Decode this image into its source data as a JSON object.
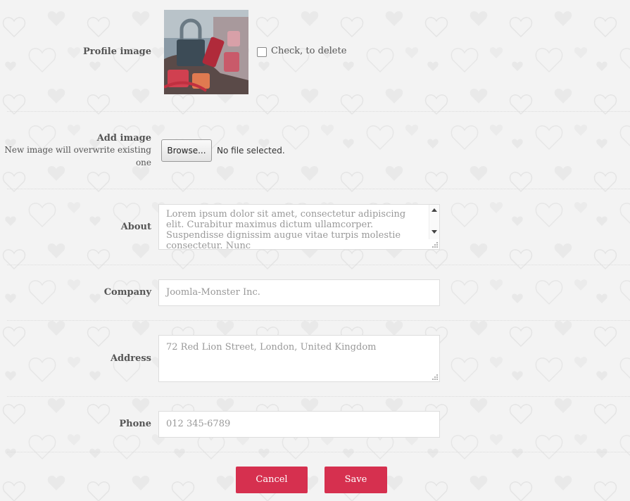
{
  "profile_image": {
    "label": "Profile image",
    "delete_checkbox_label": "Check, to delete",
    "delete_checked": false
  },
  "add_image": {
    "label": "Add image",
    "hint": "New image will overwrite existing one",
    "browse_label": "Browse...",
    "file_status": "No file selected."
  },
  "about": {
    "label": "About",
    "value": "Lorem ipsum dolor sit amet, consectetur adipiscing elit. Curabitur maximus dictum ullamcorper. Suspendisse dignissim augue vitae turpis molestie consectetur. Nunc"
  },
  "company": {
    "label": "Company",
    "placeholder": "Joomla-Monster Inc."
  },
  "address": {
    "label": "Address",
    "placeholder": "72 Red Lion Street, London, United Kingdom"
  },
  "phone": {
    "label": "Phone",
    "placeholder": "012 345-6789"
  },
  "actions": {
    "cancel_label": "Cancel",
    "save_label": "Save"
  },
  "colors": {
    "accent": "#d6304f",
    "background": "#f3f3f3"
  }
}
